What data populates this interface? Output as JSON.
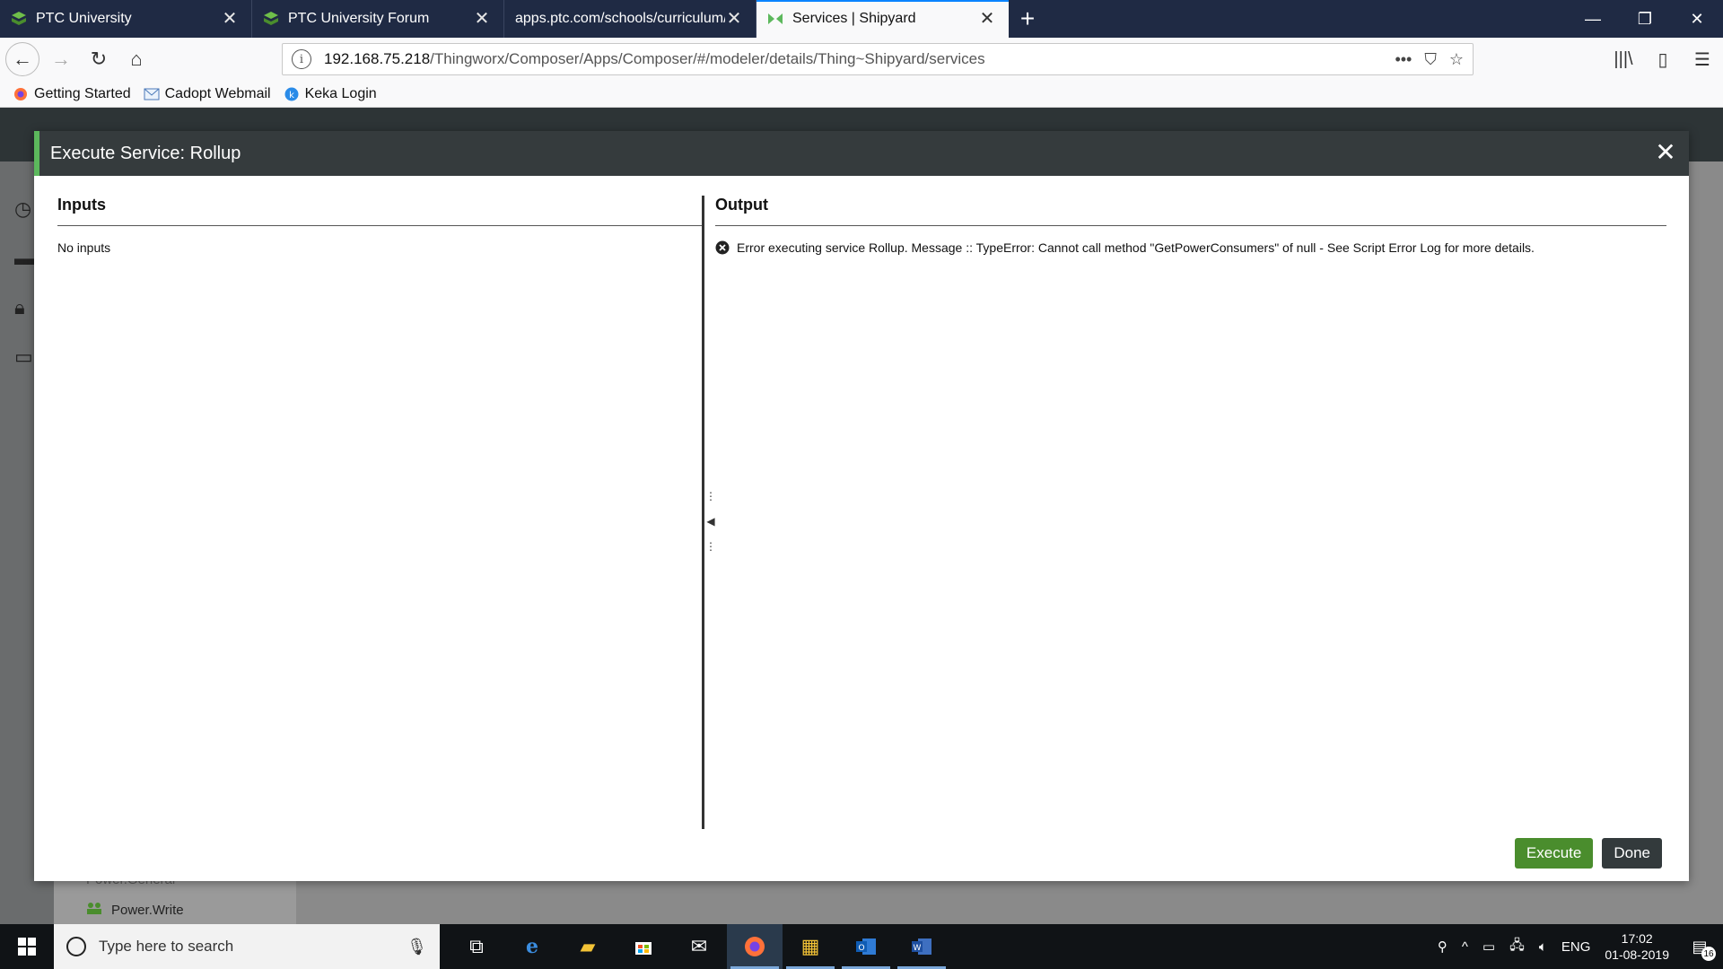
{
  "browser": {
    "tabs": [
      {
        "label": "PTC University",
        "active": false
      },
      {
        "label": "PTC University Forum",
        "active": false
      },
      {
        "label": "apps.ptc.com/schools/curriculum/n",
        "active": false
      },
      {
        "label": "Services | Shipyard",
        "active": true
      }
    ],
    "new_tab_label": "+",
    "url": {
      "host": "192.168.75.218",
      "path": "/Thingworx/Composer/Apps/Composer/#/modeler/details/Thing~Shipyard/services"
    },
    "bookmarks": [
      {
        "label": "Getting Started"
      },
      {
        "label": "Cadopt Webmail"
      },
      {
        "label": "Keka Login"
      }
    ]
  },
  "app_background": {
    "tree_items": [
      "Power.General",
      "Power.Write"
    ]
  },
  "modal": {
    "title": "Execute Service: Rollup",
    "inputs": {
      "heading": "Inputs",
      "text": "No inputs"
    },
    "output": {
      "heading": "Output",
      "message": "Error executing service Rollup. Message :: TypeError: Cannot call method \"GetPowerConsumers\" of null - See Script Error Log for more details."
    },
    "buttons": {
      "execute": "Execute",
      "done": "Done"
    }
  },
  "taskbar": {
    "search_placeholder": "Type here to search",
    "language": "ENG",
    "time": "17:02",
    "date": "01-08-2019",
    "notification_count": "16"
  },
  "colors": {
    "modal_header": "#353b3d",
    "modal_accent": "#5cb85c",
    "execute_button": "#4a8d2d",
    "done_button": "#333a3c",
    "tabstrip": "#1f2a44"
  }
}
